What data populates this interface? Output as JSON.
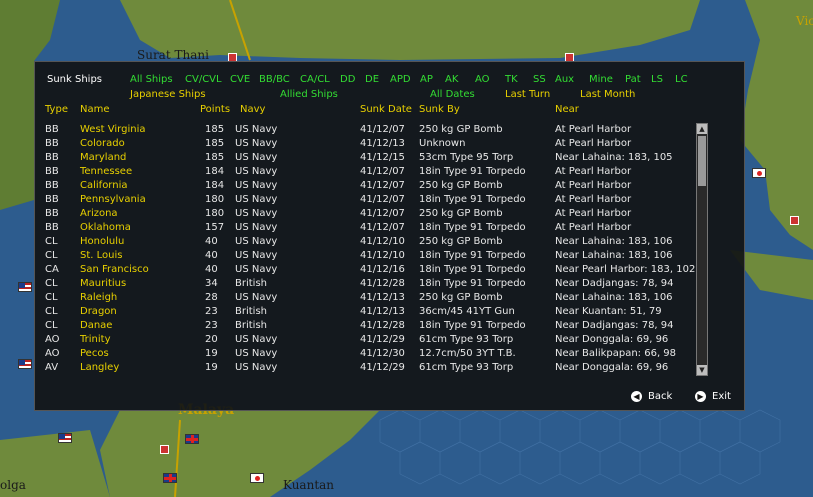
{
  "map": {
    "labels": {
      "surat_thani": "Surat Thani",
      "kuantan": "Kuantan",
      "malaya": "Malaya",
      "bolga": "olga",
      "vic": "Vic"
    }
  },
  "dialog": {
    "title": "Sunk Ships",
    "filters_row1": [
      "All Ships",
      "CV/CVL",
      "CVE",
      "BB/BC",
      "CA/CL",
      "DD",
      "DE",
      "APD",
      "AP",
      "AK",
      "AO",
      "TK",
      "SS",
      "Aux",
      "Mine",
      "Pat",
      "LS",
      "LC"
    ],
    "filters_row2": {
      "japanese": "Japanese Ships",
      "allied": "Allied Ships",
      "all_dates": "All Dates",
      "last_turn": "Last Turn",
      "last_month": "Last Month"
    },
    "columns": {
      "type": "Type",
      "name": "Name",
      "points": "Points",
      "navy": "Navy",
      "sunk_date": "Sunk Date",
      "sunk_by": "Sunk By",
      "near": "Near"
    },
    "rows": [
      {
        "type": "BB",
        "name": "West Virginia",
        "points": "185",
        "navy": "US Navy",
        "date": "41/12/07",
        "by": "250 kg GP Bomb",
        "near": "At Pearl Harbor"
      },
      {
        "type": "BB",
        "name": "Colorado",
        "points": "185",
        "navy": "US Navy",
        "date": "41/12/13",
        "by": "Unknown",
        "near": "At Pearl Harbor"
      },
      {
        "type": "BB",
        "name": "Maryland",
        "points": "185",
        "navy": "US Navy",
        "date": "41/12/15",
        "by": "53cm Type 95 Torp",
        "near": "Near Lahaina: 183, 105"
      },
      {
        "type": "BB",
        "name": "Tennessee",
        "points": "184",
        "navy": "US Navy",
        "date": "41/12/07",
        "by": "18in Type 91 Torpedo",
        "near": "At Pearl Harbor"
      },
      {
        "type": "BB",
        "name": "California",
        "points": "184",
        "navy": "US Navy",
        "date": "41/12/07",
        "by": "250 kg GP Bomb",
        "near": "At Pearl Harbor"
      },
      {
        "type": "BB",
        "name": "Pennsylvania",
        "points": "180",
        "navy": "US Navy",
        "date": "41/12/07",
        "by": "18in Type 91 Torpedo",
        "near": "At Pearl Harbor"
      },
      {
        "type": "BB",
        "name": "Arizona",
        "points": "180",
        "navy": "US Navy",
        "date": "41/12/07",
        "by": "250 kg GP Bomb",
        "near": "At Pearl Harbor"
      },
      {
        "type": "BB",
        "name": "Oklahoma",
        "points": "157",
        "navy": "US Navy",
        "date": "41/12/07",
        "by": "18in Type 91 Torpedo",
        "near": "At Pearl Harbor"
      },
      {
        "type": "CL",
        "name": "Honolulu",
        "points": "40",
        "navy": "US Navy",
        "date": "41/12/10",
        "by": "250 kg GP Bomb",
        "near": "Near Lahaina: 183, 106"
      },
      {
        "type": "CL",
        "name": "St. Louis",
        "points": "40",
        "navy": "US Navy",
        "date": "41/12/10",
        "by": "18in Type 91 Torpedo",
        "near": "Near Lahaina: 183, 106"
      },
      {
        "type": "CA",
        "name": "San Francisco",
        "points": "40",
        "navy": "US Navy",
        "date": "41/12/16",
        "by": "18in Type 91 Torpedo",
        "near": "Near Pearl Harbor: 183, 102"
      },
      {
        "type": "CL",
        "name": "Mauritius",
        "points": "34",
        "navy": "British",
        "date": "41/12/28",
        "by": "18in Type 91 Torpedo",
        "near": "Near Dadjangas: 78, 94"
      },
      {
        "type": "CL",
        "name": "Raleigh",
        "points": "28",
        "navy": "US Navy",
        "date": "41/12/13",
        "by": "250 kg GP Bomb",
        "near": "Near Lahaina: 183, 106"
      },
      {
        "type": "CL",
        "name": "Dragon",
        "points": "23",
        "navy": "British",
        "date": "41/12/13",
        "by": "36cm/45 41YT Gun",
        "near": "Near Kuantan: 51, 79"
      },
      {
        "type": "CL",
        "name": "Danae",
        "points": "23",
        "navy": "British",
        "date": "41/12/28",
        "by": "18in Type 91 Torpedo",
        "near": "Near Dadjangas: 78, 94"
      },
      {
        "type": "AO",
        "name": "Trinity",
        "points": "20",
        "navy": "US Navy",
        "date": "41/12/29",
        "by": "61cm Type 93 Torp",
        "near": "Near Donggala: 69, 96"
      },
      {
        "type": "AO",
        "name": "Pecos",
        "points": "19",
        "navy": "US Navy",
        "date": "41/12/30",
        "by": "12.7cm/50 3YT T.B.",
        "near": "Near Balikpapan: 66, 98"
      },
      {
        "type": "AV",
        "name": "Langley",
        "points": "19",
        "navy": "US Navy",
        "date": "41/12/29",
        "by": "61cm Type 93 Torp",
        "near": "Near Donggala: 69, 96"
      }
    ],
    "back_label": "Back",
    "exit_label": "Exit"
  }
}
